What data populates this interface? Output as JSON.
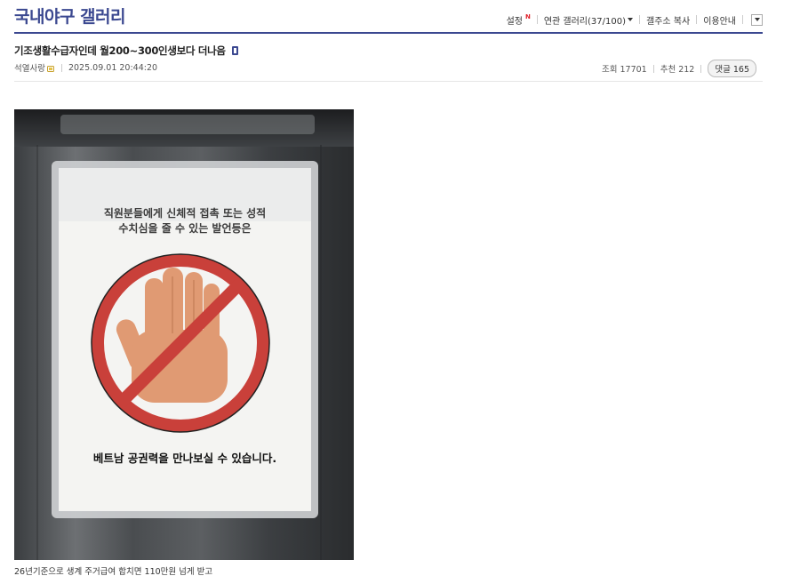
{
  "gallery": {
    "title": "국내야구 갤러리"
  },
  "top_menu": {
    "settings": {
      "label": "설정",
      "badge": "N"
    },
    "related_galleries": {
      "label": "연관 갤러리(37/100)"
    },
    "copy_address": {
      "label": "갤주소 복사"
    },
    "usage_guide": {
      "label": "이용안내"
    }
  },
  "post": {
    "title": "기조생활수급자인데 월200~300인생보다 더나음",
    "author": "석열사랑",
    "datetime": "2025.09.01 20:44:20",
    "views": "조회 17701",
    "recommends": "추천 212",
    "comments": "댓글 165"
  },
  "poster": {
    "line1": "직원분들에게 신체적 접촉 또는 성적",
    "line2": "수치심을 줄 수 있는 발언등은",
    "bottom": "베트남 공권력을 만나보실 수 있습니다."
  },
  "caption": "26년기준으로 생계 주거급여 합치면 110만원 넘게 받고",
  "colors": {
    "brand": "#3b4890",
    "new_badge": "#e0202a",
    "prohibition_sign": "#c9403a",
    "hand": "#e09a73"
  },
  "icons": {
    "mobile": "mobile-icon",
    "nickname": "fixed-nickname-icon",
    "dropdown": "chevron-down-icon"
  }
}
